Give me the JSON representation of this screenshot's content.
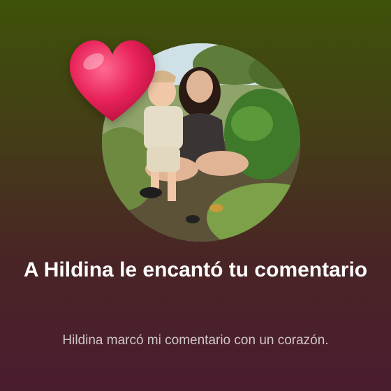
{
  "notification": {
    "title": "A Hildina le encantó tu comentario",
    "message": "Hildina marcó mi comentario con un corazón."
  },
  "icons": {
    "reaction": "heart-icon"
  },
  "colors": {
    "heart": "#e8235a",
    "title_text": "#ffffff",
    "message_text": "#cfc7c7",
    "background_top": "#3e5209",
    "background_bottom": "#4a1c2f"
  }
}
